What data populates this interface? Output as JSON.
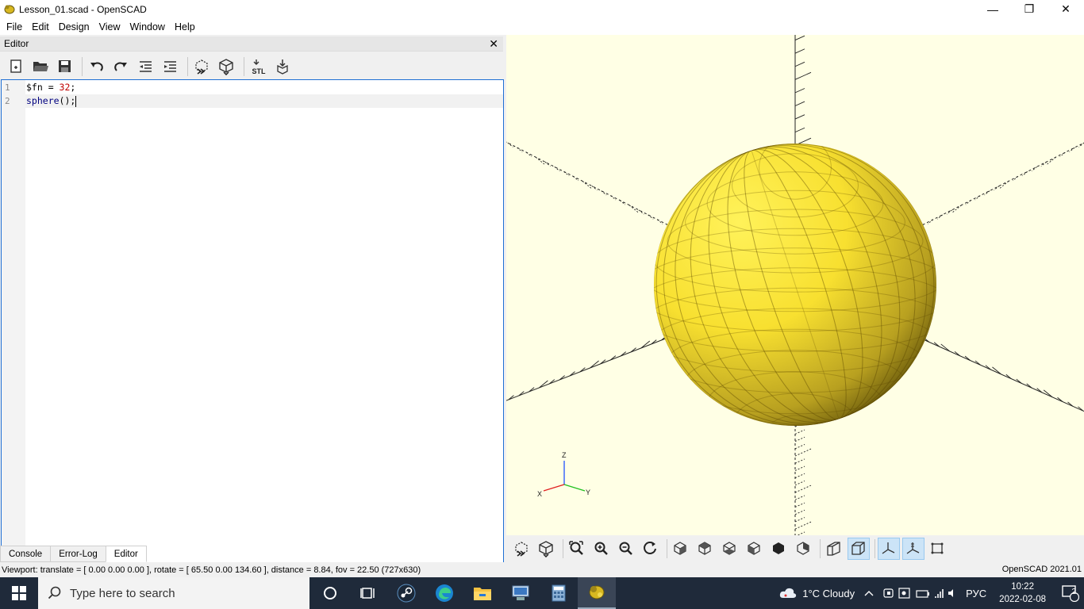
{
  "window": {
    "title": "Lesson_01.scad - OpenSCAD",
    "minimize": "—",
    "maximize": "❐",
    "close": "✕"
  },
  "menu": [
    "File",
    "Edit",
    "Design",
    "View",
    "Window",
    "Help"
  ],
  "editor": {
    "dock_title": "Editor",
    "close_glyph": "✕",
    "toolbar": [
      {
        "name": "new-file-icon"
      },
      {
        "name": "open-file-icon"
      },
      {
        "name": "save-icon"
      },
      {
        "sep": true
      },
      {
        "name": "undo-icon"
      },
      {
        "name": "redo-icon"
      },
      {
        "name": "unindent-icon"
      },
      {
        "name": "indent-icon"
      },
      {
        "sep": true
      },
      {
        "name": "preview-icon"
      },
      {
        "name": "render-icon"
      },
      {
        "sep": true
      },
      {
        "name": "export-stl-icon",
        "label": "STL"
      },
      {
        "name": "send-to-print-icon"
      }
    ],
    "lines": [
      {
        "num": "1",
        "parts": [
          {
            "t": "$fn = ",
            "c": ""
          },
          {
            "t": "32",
            "c": "num"
          },
          {
            "t": ";",
            "c": ""
          }
        ]
      },
      {
        "num": "2",
        "parts": [
          {
            "t": "sphere",
            "c": "kw"
          },
          {
            "t": "();",
            "c": ""
          }
        ]
      }
    ]
  },
  "bottom_tabs": [
    "Console",
    "Error-Log",
    "Editor"
  ],
  "active_tab": 2,
  "viewport": {
    "background": "#ffffe5",
    "sphere_color": "#f8e030",
    "axis_labels": {
      "x": "X",
      "y": "Y",
      "z": "Z"
    }
  },
  "viewport_toolbar": [
    {
      "name": "preview-icon"
    },
    {
      "name": "render-icon"
    },
    {
      "sep": true
    },
    {
      "name": "view-all-icon"
    },
    {
      "name": "zoom-in-icon"
    },
    {
      "name": "zoom-out-icon"
    },
    {
      "name": "reset-view-icon"
    },
    {
      "sep": true
    },
    {
      "name": "view-right-icon"
    },
    {
      "name": "view-top-icon"
    },
    {
      "name": "view-bottom-icon"
    },
    {
      "name": "view-left-icon"
    },
    {
      "name": "view-front-icon"
    },
    {
      "name": "view-back-icon"
    },
    {
      "sep": true
    },
    {
      "name": "perspective-icon"
    },
    {
      "name": "orthogonal-icon",
      "pressed": true
    },
    {
      "sep": true
    },
    {
      "name": "show-axes-icon",
      "pressed": true
    },
    {
      "name": "show-scale-markers-icon",
      "pressed": true
    },
    {
      "name": "show-edges-icon"
    }
  ],
  "status": {
    "left": "Viewport: translate = [ 0.00 0.00 0.00 ], rotate = [ 65.50 0.00 134.60 ], distance = 8.84, fov = 22.50 (727x630)",
    "right": "OpenSCAD 2021.01"
  },
  "taskbar": {
    "search_placeholder": "Type here to search",
    "weather": "1°C  Cloudy",
    "language": "РУС",
    "time": "10:22",
    "date": "2022-02-08",
    "notifications": "2"
  }
}
